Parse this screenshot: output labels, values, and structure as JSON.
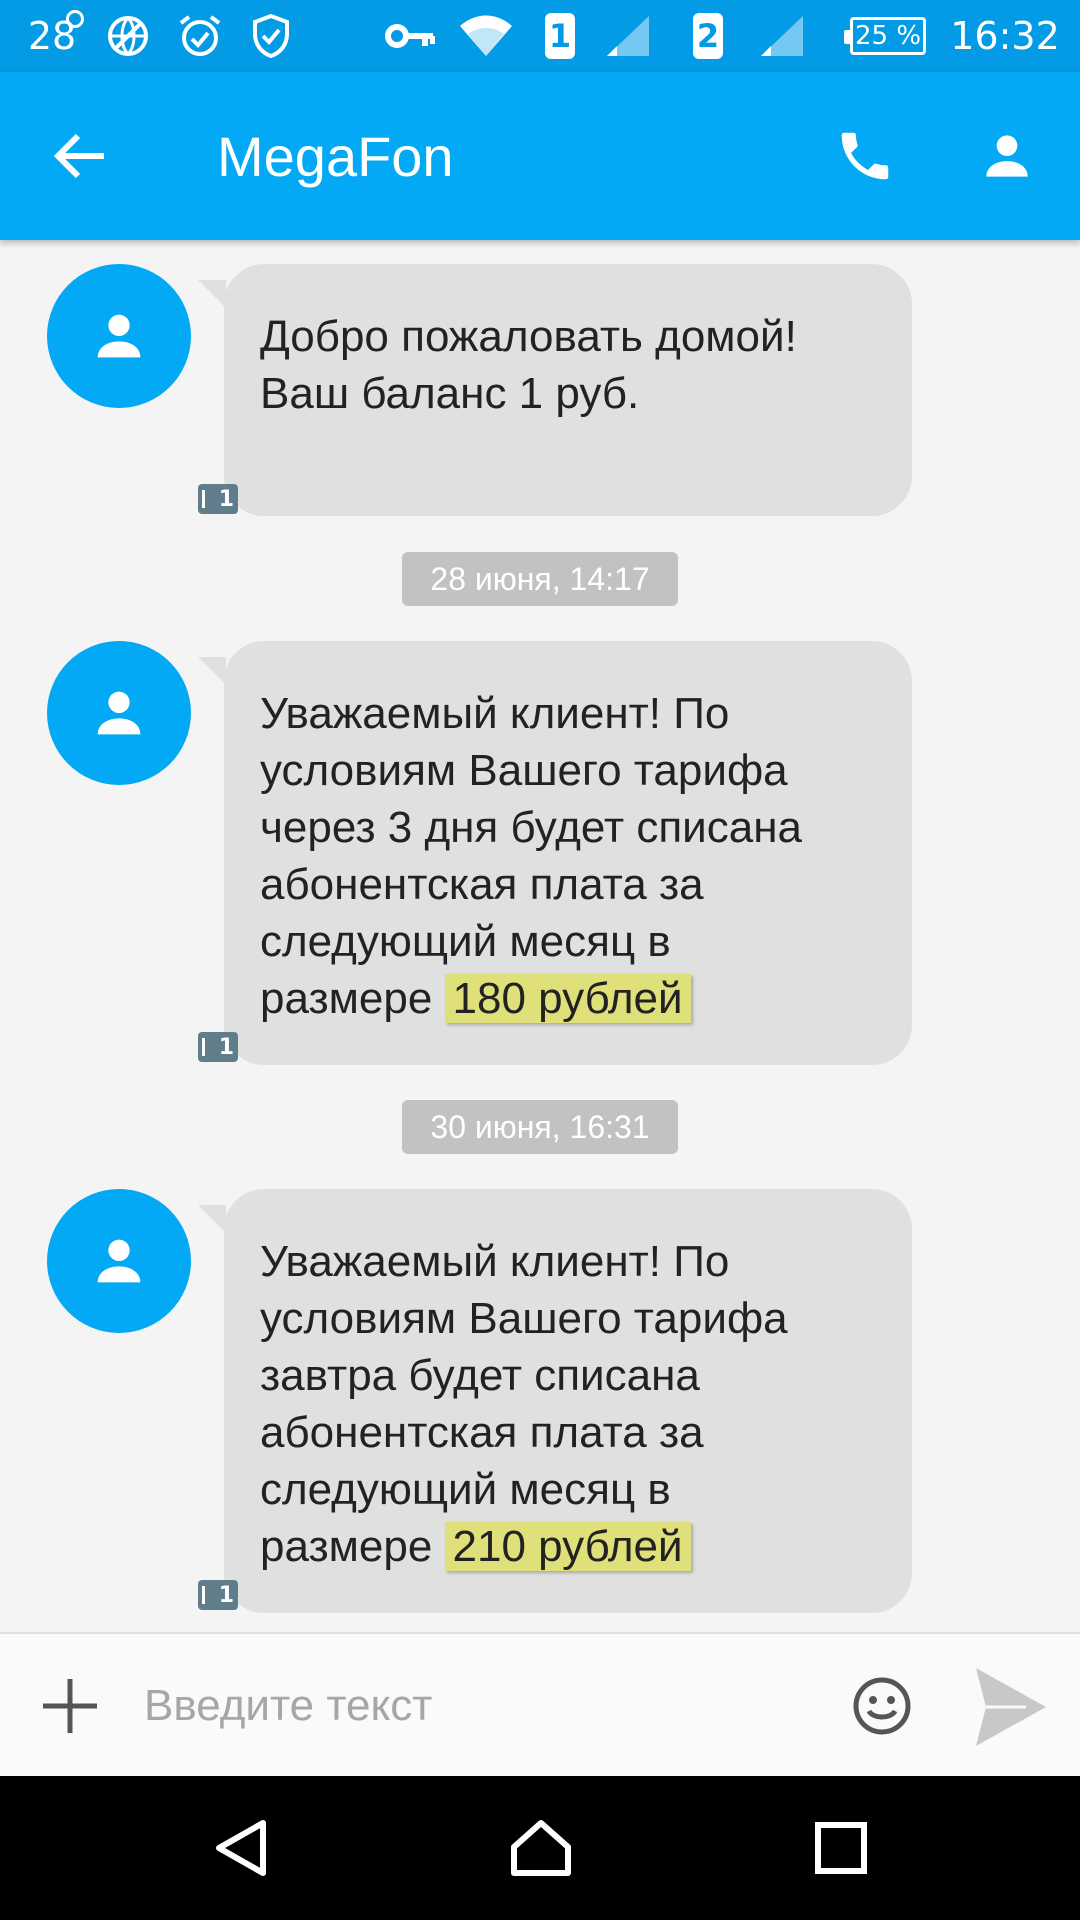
{
  "status_bar": {
    "notification_count": "28",
    "sim1_label": "1",
    "sim2_label": "2",
    "battery": "25 %",
    "time": "16:32",
    "icons": [
      "notification-icon",
      "vpn-globe-icon",
      "alarm-icon",
      "shield-check-icon",
      "key-icon",
      "wifi-icon",
      "signal-sim1-icon",
      "signal-sim2-icon",
      "battery-icon"
    ]
  },
  "app_bar": {
    "title": "MegaFon",
    "back_icon": "back-arrow-icon",
    "call_icon": "phone-icon",
    "contact_icon": "person-icon"
  },
  "messages": [
    {
      "lines": [
        "Добро пожаловать домой!",
        "Ваш баланс 1 руб."
      ],
      "sim": "1"
    },
    {
      "date": "28 июня, 14:17",
      "lines": [
        "Уважаемый клиент! По",
        "условиям Вашего тарифа",
        "через 3 дня будет списана",
        "абонентская плата за",
        "следующий месяц в"
      ],
      "last_prefix": "размере",
      "highlight": "180 рублей",
      "sim": "1"
    },
    {
      "date": "30 июня, 16:31",
      "lines": [
        "Уважаемый клиент! По",
        "условиям Вашего тарифа",
        "завтра будет списана",
        "абонентская плата за",
        "следующий месяц в"
      ],
      "last_prefix": "размере",
      "highlight": "210 рублей",
      "sim": "1"
    }
  ],
  "compose": {
    "placeholder": "Введите текст",
    "add_icon": "plus-icon",
    "emoji_icon": "smiley-icon",
    "send_icon": "send-icon"
  },
  "nav_bar": {
    "icons": [
      "nav-back-icon",
      "nav-home-icon",
      "nav-recents-icon"
    ]
  },
  "colors": {
    "status_bar": "#039be5",
    "app_bar": "#03a9f4",
    "bubble": "#e0e0e0",
    "highlight": "#e0e07a",
    "date_chip": "#c2c2c2"
  }
}
